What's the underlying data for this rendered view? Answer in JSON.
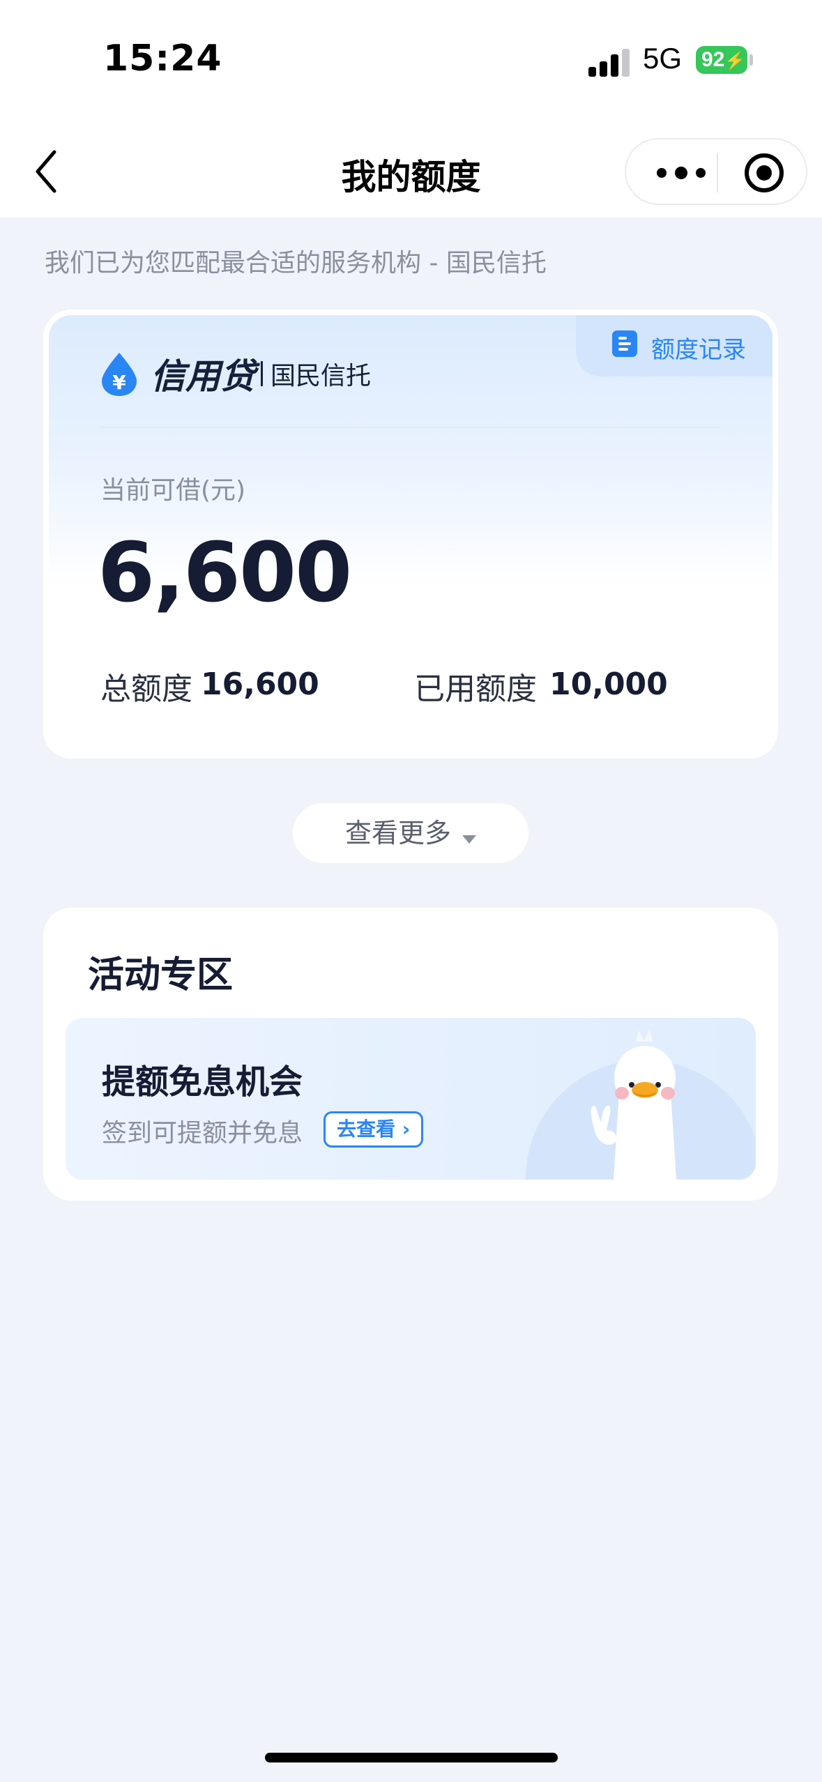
{
  "status_bar": {
    "time": "15:24",
    "network": "5G",
    "battery": "92"
  },
  "nav": {
    "title": "我的额度"
  },
  "notice": "我们已为您匹配最合适的服务机构 - 国民信托",
  "quota_card": {
    "record_label": "额度记录",
    "brand_name": "信用贷",
    "brand_org": "国民信托",
    "available_label": "当前可借(元)",
    "available_value": "6,600",
    "total_label": "总额度",
    "total_value": "16,600",
    "used_label": "已用额度",
    "used_value": "10,000"
  },
  "more_button": {
    "label": "查看更多"
  },
  "activity": {
    "title": "活动专区",
    "promo": {
      "title": "提额免息机会",
      "subtitle": "签到可提额并免息",
      "button_label": "去查看"
    }
  },
  "colors": {
    "accent": "#2a86f5",
    "battery_green": "#35c759",
    "page_bg": "#f0f3f9"
  }
}
